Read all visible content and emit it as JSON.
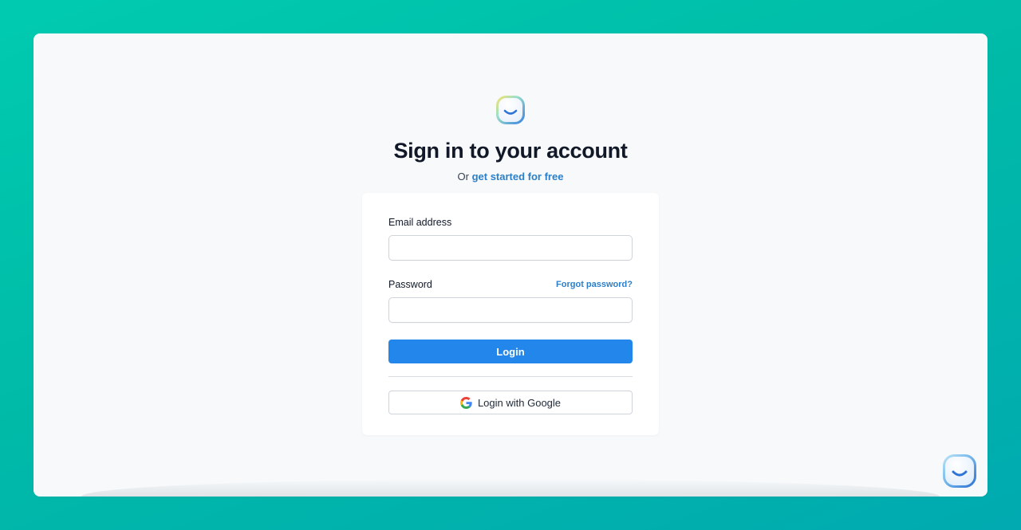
{
  "header": {
    "logo_icon": "smiley-logo-icon",
    "title": "Sign in to your account",
    "subtitle_prefix": "Or",
    "signup_link": "get started for free"
  },
  "form": {
    "email_label": "Email address",
    "email_value": "",
    "email_placeholder": "",
    "password_label": "Password",
    "password_value": "",
    "password_placeholder": "",
    "forgot_link": "Forgot password?",
    "login_button": "Login",
    "google_button": "Login with Google",
    "google_icon": "google-g-icon"
  },
  "widget": {
    "icon": "smiley-chat-icon"
  },
  "colors": {
    "background_gradient_start": "#00cbb0",
    "background_gradient_end": "#00aab0",
    "frame_background": "#f7f9fb",
    "primary_button": "#2386ea",
    "link": "#2b7fc9",
    "title_text": "#111827"
  }
}
